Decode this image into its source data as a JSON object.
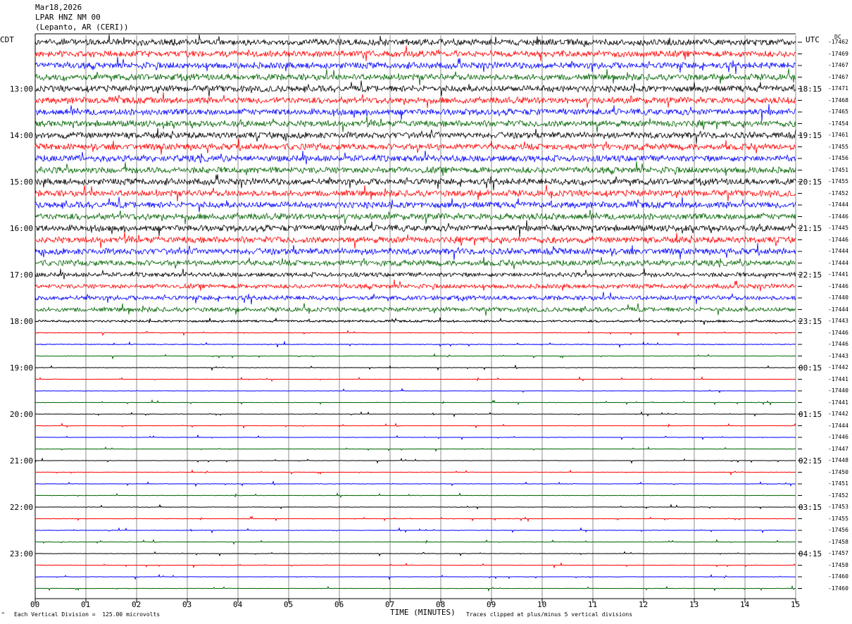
{
  "header": {
    "date": "Mar18,2026",
    "station": "LPAR HNZ NM 00",
    "location": "(Lepanto, AR (CERI))"
  },
  "left_axis_label": "CDT",
  "right_axis_label": "UTC",
  "dc_label": "DC",
  "footer": {
    "xlabel": "TIME (MINUTES)",
    "scale_note": "Each Vertical Division =  125.00 microvolts",
    "clip_note": "Traces clipped at plus/minus 5 vertical divisions",
    "corner_mark": "^"
  },
  "chart_data": {
    "type": "line",
    "title": "Mar18,2026 LPAR HNZ NM 00 (Lepanto, AR (CERI))",
    "xlabel": "TIME (MINUTES)",
    "ylabel": "",
    "xlim": [
      0,
      15
    ],
    "x_ticks": [
      "00",
      "01",
      "02",
      "03",
      "04",
      "05",
      "06",
      "07",
      "08",
      "09",
      "10",
      "11",
      "12",
      "13",
      "14",
      "15"
    ],
    "cdt_hours": [
      "13:00",
      "14:00",
      "15:00",
      "16:00",
      "17:00",
      "18:00",
      "19:00",
      "20:00",
      "21:00",
      "22:00",
      "23:00"
    ],
    "utc_hours": [
      "18:15",
      "19:15",
      "20:15",
      "21:15",
      "22:15",
      "23:15",
      "00:15",
      "01:15",
      "02:15",
      "03:15",
      "04:15"
    ],
    "trace_colors": [
      "#000000",
      "#ff0000",
      "#0000ff",
      "#006400"
    ],
    "dc_offsets": [
      "-17462",
      "-17469",
      "-17467",
      "-17467",
      "-17471",
      "-17468",
      "-17465",
      "-17454",
      "-17461",
      "-17455",
      "-17456",
      "-17451",
      "-17455",
      "-17452",
      "-17444",
      "-17446",
      "-17445",
      "-17446",
      "-17444",
      "-17444",
      "-17441",
      "-17446",
      "-17440",
      "-17444",
      "-17443",
      "-17446",
      "-17446",
      "-17443",
      "-17442",
      "-17441",
      "-17440",
      "-17441",
      "-17442",
      "-17444",
      "-17446",
      "-17447",
      "-17448",
      "-17450",
      "-17451",
      "-17452",
      "-17453",
      "-17455",
      "-17456",
      "-17458",
      "-17457",
      "-17458",
      "-17460",
      "-17460"
    ],
    "trace_amplitude": [
      5,
      5,
      5,
      5,
      5,
      5,
      5,
      5,
      5,
      5,
      5,
      5,
      5,
      5,
      5,
      5,
      5,
      5,
      5,
      4.5,
      3.5,
      3.5,
      3.5,
      3.5,
      1.6,
      0.5,
      0.6,
      0.35,
      0.3,
      0.25,
      0.25,
      0.25,
      0.25,
      0.25,
      0.25,
      0.25,
      0.25,
      0.3,
      0.3,
      0.3,
      0.3,
      0.3,
      0.3,
      0.3,
      0.3,
      0.25,
      0.25,
      0.25
    ],
    "grid": true,
    "scale_microvolts_per_division": 125.0,
    "clip_divisions": 5
  }
}
